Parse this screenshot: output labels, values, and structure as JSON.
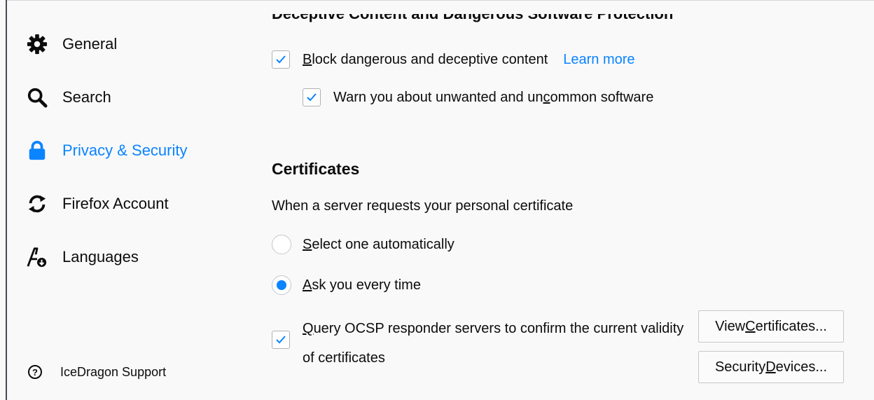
{
  "sidebar": {
    "items": [
      {
        "label": "General",
        "icon": "gear-icon"
      },
      {
        "label": "Search",
        "icon": "search-icon"
      },
      {
        "label": "Privacy & Security",
        "icon": "lock-icon",
        "active": true
      },
      {
        "label": "Firefox Account",
        "icon": "sync-icon"
      },
      {
        "label": "Languages",
        "icon": "languages-icon"
      }
    ],
    "support": {
      "label": "IceDragon Support",
      "icon": "help-icon"
    }
  },
  "main": {
    "partial_heading": "Deceptive Content and Dangerous Software Protection",
    "block_dangerous": {
      "pre": "",
      "accel": "B",
      "post": "lock dangerous and deceptive content",
      "checked": true
    },
    "learn_more": "Learn more",
    "warn_unwanted": {
      "pre": "Warn you about unwanted and un",
      "accel": "c",
      "post": "ommon software",
      "checked": true
    },
    "certificates": {
      "heading": "Certificates",
      "description": "When a server requests your personal certificate",
      "options": [
        {
          "pre": "",
          "accel": "S",
          "post": "elect one automatically",
          "selected": false
        },
        {
          "pre": "",
          "accel": "A",
          "post": "sk you every time",
          "selected": true
        }
      ],
      "ocsp": {
        "pre": "",
        "accel": "Q",
        "post": "uery OCSP responder servers to confirm the current validity of certificates",
        "checked": true
      },
      "view_certificates": {
        "pre": "View ",
        "accel": "C",
        "post": "ertificates..."
      },
      "security_devices": {
        "pre": "Security ",
        "accel": "D",
        "post": "evices..."
      }
    }
  },
  "colors": {
    "accent": "#0a84ff",
    "text": "#0c0c0d",
    "background": "#f9f9fa"
  }
}
